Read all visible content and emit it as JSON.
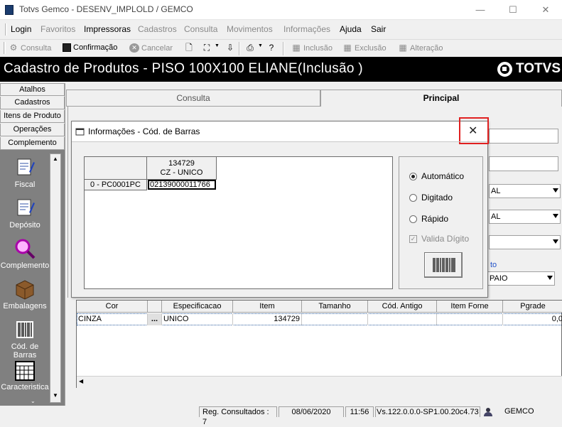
{
  "window": {
    "title": "Totvs Gemco - DESENV_IMPLOLD / GEMCO",
    "minimize": "—",
    "maximize": "☐",
    "close": "✕"
  },
  "menu": [
    {
      "label": "Login",
      "enabled": true
    },
    {
      "label": "Favoritos",
      "enabled": false
    },
    {
      "label": "Impressoras",
      "enabled": true
    },
    {
      "label": "Cadastros",
      "enabled": false
    },
    {
      "label": "Consulta",
      "enabled": false
    },
    {
      "label": "Movimentos",
      "enabled": false
    },
    {
      "label": "Informações",
      "enabled": false
    },
    {
      "label": "Ajuda",
      "enabled": true
    },
    {
      "label": "Sair",
      "enabled": true
    }
  ],
  "toolbar": {
    "consulta": "Consulta",
    "confirmacao": "Confirmação",
    "cancelar": "Cancelar",
    "inclusao": "Inclusão",
    "exclusao": "Exclusão",
    "alteracao": "Alteração"
  },
  "header": {
    "title": "Cadastro de Produtos  - PISO 100X100 ELIANE(Inclusão )",
    "logo": "TOTVS"
  },
  "nav": {
    "tabs": [
      "Atalhos",
      "Cadastros",
      "Itens de Produto",
      "Operações",
      "Complemento"
    ],
    "items": [
      "Fiscal",
      "Depósito",
      "Complemento",
      "Embalagens",
      "Cód. de Barras",
      "Caracteristica"
    ]
  },
  "main_tabs": {
    "consulta": "Consulta",
    "principal": "Principal"
  },
  "form_bg": {
    "combo1": "AL",
    "combo2": "AL",
    "link_text": "to",
    "combo4": "PAIO"
  },
  "dialog": {
    "title": "Informações  - Cód. de Barras",
    "close": "✕",
    "grid": {
      "col_header_line1": "134729",
      "col_header_line2": "CZ - UNICO",
      "row_header": "0 - PC0001PC",
      "cell_value": "02139000011766"
    },
    "radios": [
      {
        "label": "Automático",
        "selected": true
      },
      {
        "label": "Digitado",
        "selected": false
      },
      {
        "label": "Rápido",
        "selected": false
      }
    ],
    "checkbox": {
      "label": "Valida Dígito",
      "checked": true,
      "enabled": false
    }
  },
  "lower_grid": {
    "headers": [
      "Cor",
      "Especificacao",
      "Item",
      "Tamanho",
      "Cód. Antigo",
      "Item Forne",
      "Pgrade"
    ],
    "row": {
      "cor": "CINZA",
      "ellipsis": "...",
      "especificacao": "UNICO",
      "item": "134729",
      "pgrade": "0,0"
    }
  },
  "status": {
    "reg": "Reg. Consultados : 7",
    "date": "08/06/2020",
    "time": "11:56",
    "version": "Vs.122.0.0.0-SP1.00.20c4.73",
    "user": "GEMCO"
  },
  "colors": {
    "header_bg": "#000000",
    "highlight_box": "#e02020",
    "nav_panel": "#808080"
  }
}
